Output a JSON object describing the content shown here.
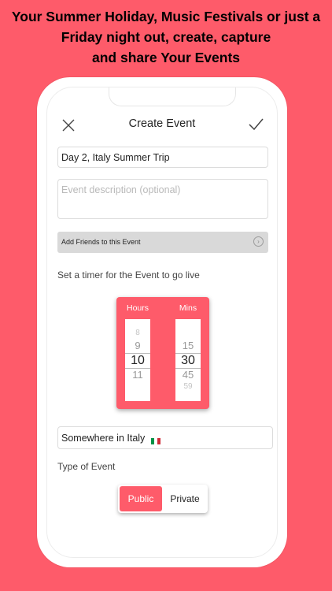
{
  "promo": {
    "line1": "Your Summer Holiday, Music Festivals or just a",
    "line2": "Friday night out, create, capture",
    "line3": "and share Your Events"
  },
  "header": {
    "title": "Create Event",
    "close_icon": "close-icon",
    "confirm_icon": "checkmark-icon"
  },
  "form": {
    "event_title_value": "Day 2, Italy Summer Trip",
    "description_placeholder": "Event description (optional)",
    "add_friends_label": "Add Friends to this Event",
    "timer_label": "Set a timer for the Event to go live",
    "location_value": "Somewhere in Italy",
    "type_label": "Type of Event"
  },
  "timer": {
    "hours_label": "Hours",
    "mins_label": "Mins",
    "hours_values": [
      "8",
      "9",
      "10",
      "11"
    ],
    "mins_values": [
      "15",
      "30",
      "45",
      "59"
    ],
    "selected_hours": "10",
    "selected_mins": "30"
  },
  "event_type": {
    "options": [
      "Public",
      "Private"
    ],
    "selected": "Public"
  },
  "colors": {
    "accent": "#fe5b6a",
    "flag_green": "#009246",
    "flag_white": "#ffffff",
    "flag_red": "#ce2b37"
  }
}
